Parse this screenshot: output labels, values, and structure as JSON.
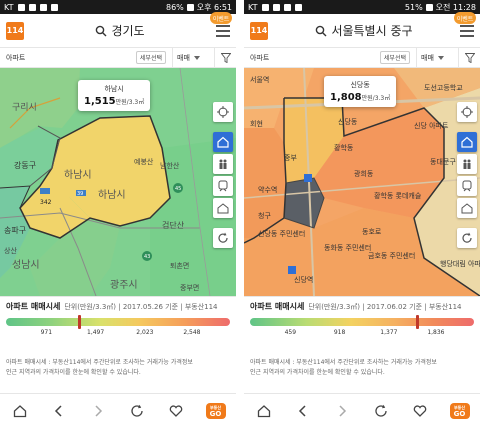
{
  "left": {
    "status": {
      "carrier": "KT",
      "battery": "86%",
      "time": "오후 6:51"
    },
    "app": {
      "logo": "114",
      "search": "경기도",
      "event_badge": "이벤트"
    },
    "filter": {
      "type": "아파트",
      "detail_button": "세부선택",
      "trade": "매매"
    },
    "map_labels": {
      "guri": "구리시",
      "gangdong": "강동구",
      "hanam": "하남시",
      "hanam2": "하남시",
      "songpa": "송파구",
      "seongnam": "성남시",
      "sangsan": "상산",
      "yebongsan": "예봉산",
      "nammasan": "남한산",
      "geumam": "검단산",
      "gwangju": "광주시",
      "toechon": "퇴촌면",
      "jungbu": "중부면",
      "route1": "342",
      "route2": "43",
      "route3": "45",
      "route4": "39"
    },
    "price_card": {
      "area": "하남시",
      "price": "1,515",
      "unit": "만원/3.3㎡"
    },
    "legend": {
      "title": "아파트 매매시세",
      "info": "단위(만원/3.3㎡) | 2017.05.26 기준 | 부동산114",
      "ticks": [
        "971",
        "1,497",
        "2,023",
        "2,548"
      ],
      "marker_fraction": 0.32,
      "note": "아파트 매매시세 : 부동산114에서 주간단위로 조사하는 거래가능 가격정보\n인근 지역과의 가격차이를 한눈에 확인할 수 있습니다."
    }
  },
  "right": {
    "status": {
      "carrier": "KT",
      "battery": "51%",
      "time": "오전 11:28"
    },
    "app": {
      "logo": "114",
      "search": "서울특별시 중구",
      "event_badge": "이벤트"
    },
    "filter": {
      "type": "아파트",
      "detail_button": "세부선택",
      "trade": "매매"
    },
    "map_labels": {
      "seoul_station": "서울역",
      "jungbu": "중부",
      "shindang": "신당동",
      "yaksu": "약수역",
      "cheonggu": "청구",
      "hwanghak": "황학동",
      "sindang_center": "신당동\n주민센터",
      "dongho": "동호로",
      "haengdang": "행당대림\n아파트",
      "dongdaemun": "동대문구",
      "hwanghakland": "황학동\n롯데캐슬",
      "station1": "신당역",
      "hoehyeon": "회현",
      "geumho": "금호동\n주민센터",
      "dongwha": "동화동\n주민센터",
      "dosin": "도선고등학교",
      "sindang_apt": "신당\n아파트",
      "kwanghee": "광희동"
    },
    "price_card": {
      "area": "신당동",
      "price": "1,808",
      "unit": "만원/3.3㎡"
    },
    "legend": {
      "title": "아파트 매매시세",
      "info": "단위(만원/3.3㎡) | 2017.06.02 기준 | 부동산114",
      "ticks": [
        "459",
        "918",
        "1,377",
        "1,836"
      ],
      "marker_fraction": 0.74,
      "note": "아파트 매매시세 : 부동산114에서 주간단위로 조사하는 거래가능 가격정보\n인근 지역과의 가격차이를 한눈에 확인할 수 있습니다."
    }
  },
  "colors": {
    "brand": "#f07a1a",
    "tool_active": "#2f6fd6",
    "marker": "#c0392b"
  }
}
